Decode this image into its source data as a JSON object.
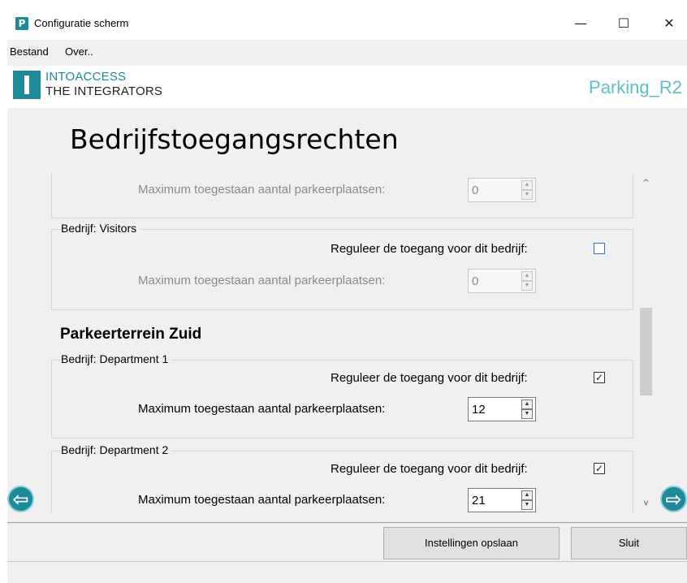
{
  "window": {
    "icon_letter": "P",
    "title": "Configuratie scherm",
    "minimize_glyph": "—",
    "maximize_glyph": "☐",
    "close_glyph": "✕"
  },
  "menu": {
    "items": [
      "Bestand",
      "Over.."
    ]
  },
  "header": {
    "logo_line1": "INTOACCESS",
    "logo_line2": "THE INTEGRATORS",
    "site_name": "Parking_R2"
  },
  "page": {
    "title": "Bedrijfstoegangsrechten"
  },
  "form": {
    "regulate_label": "Reguleer de toegang voor dit bedrijf:",
    "max_label": "Maximum toegestaan aantal parkeerplaatsen:",
    "top_partial_group": {
      "max_value": "0",
      "enabled": false
    },
    "visitors_group": {
      "legend": "Bedrijf: Visitors",
      "regulate_checked": false,
      "max_value": "0",
      "enabled": false
    },
    "section_zuid": {
      "heading": "Parkeerterrein Zuid",
      "groups": [
        {
          "legend": "Bedrijf: Department 1",
          "regulate_checked": true,
          "max_value": "12",
          "enabled": true
        },
        {
          "legend": "Bedrijf: Department 2",
          "regulate_checked": true,
          "max_value": "21",
          "enabled": true
        }
      ]
    }
  },
  "scrollbar": {
    "up_glyph": "^",
    "down_glyph": "v"
  },
  "nav": {
    "prev_glyph": "⇦",
    "next_glyph": "⇨"
  },
  "actions": {
    "save_label": "Instellingen opslaan",
    "close_label": "Sluit"
  },
  "colors": {
    "brand": "#1e8a9a",
    "site_name": "#5cc0c6",
    "checkbox_focus": "#2c6fd6"
  }
}
